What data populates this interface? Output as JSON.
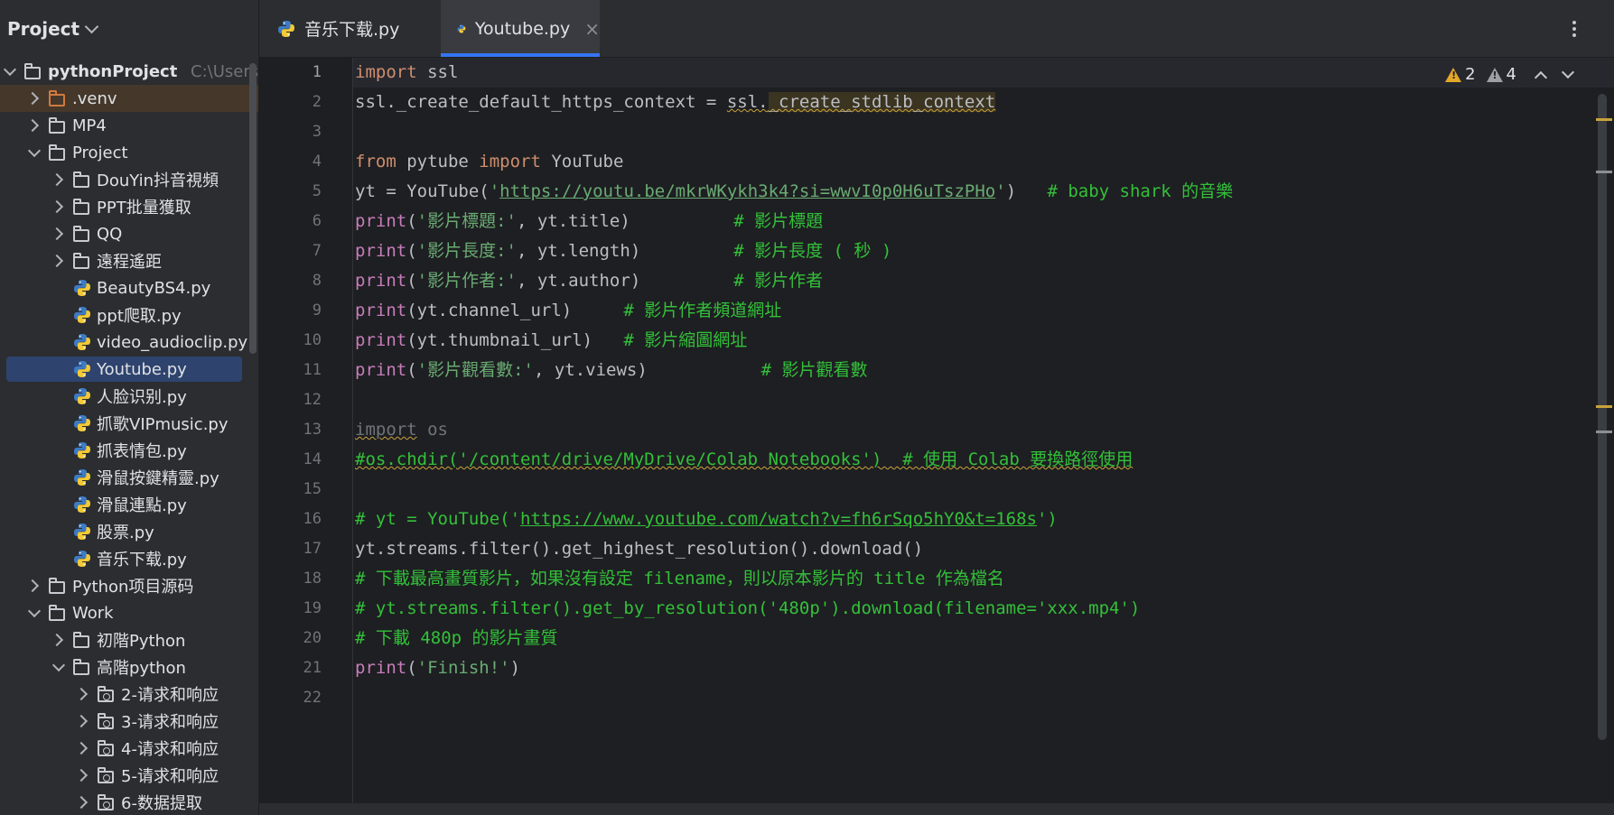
{
  "sidebar": {
    "header_label": "Project",
    "tree": [
      {
        "label": "pythonProject",
        "hint": "C:\\Users\\",
        "type": "folder",
        "expanded": true,
        "depth": 0,
        "bold": true
      },
      {
        "label": ".venv",
        "type": "folder-venv",
        "expanded": false,
        "depth": 1
      },
      {
        "label": "MP4",
        "type": "folder",
        "expanded": false,
        "depth": 1
      },
      {
        "label": "Project",
        "type": "folder",
        "expanded": true,
        "depth": 1
      },
      {
        "label": "DouYin抖音視頻",
        "type": "folder",
        "expanded": false,
        "depth": 2
      },
      {
        "label": "PPT批量獲取",
        "type": "folder",
        "expanded": false,
        "depth": 2
      },
      {
        "label": "QQ",
        "type": "folder",
        "expanded": false,
        "depth": 2
      },
      {
        "label": "遠程遙距",
        "type": "folder",
        "expanded": false,
        "depth": 2
      },
      {
        "label": "BeautyBS4.py",
        "type": "py",
        "depth": 2
      },
      {
        "label": "ppt爬取.py",
        "type": "py",
        "depth": 2
      },
      {
        "label": "video_audioclip.py",
        "type": "py",
        "depth": 2
      },
      {
        "label": "Youtube.py",
        "type": "py",
        "depth": 2,
        "selected": true
      },
      {
        "label": "人脸识别.py",
        "type": "py",
        "depth": 2
      },
      {
        "label": "抓歌VIPmusic.py",
        "type": "py",
        "depth": 2
      },
      {
        "label": "抓表情包.py",
        "type": "py",
        "depth": 2
      },
      {
        "label": "滑鼠按鍵精靈.py",
        "type": "py",
        "depth": 2
      },
      {
        "label": "滑鼠連點.py",
        "type": "py",
        "depth": 2
      },
      {
        "label": "股票.py",
        "type": "py",
        "depth": 2
      },
      {
        "label": "音乐下载.py",
        "type": "py",
        "depth": 2
      },
      {
        "label": "Python项目源码",
        "type": "folder",
        "expanded": false,
        "depth": 1
      },
      {
        "label": "Work",
        "type": "folder",
        "expanded": true,
        "depth": 1
      },
      {
        "label": "初階Python",
        "type": "folder",
        "expanded": false,
        "depth": 2
      },
      {
        "label": "高階python",
        "type": "folder",
        "expanded": true,
        "depth": 2
      },
      {
        "label": "2-请求和响应",
        "type": "package",
        "expanded": false,
        "depth": 3
      },
      {
        "label": "3-请求和响应",
        "type": "package",
        "expanded": false,
        "depth": 3
      },
      {
        "label": "4-请求和响应",
        "type": "package",
        "expanded": false,
        "depth": 3
      },
      {
        "label": "5-请求和响应",
        "type": "package",
        "expanded": false,
        "depth": 3
      },
      {
        "label": "6-数据提取",
        "type": "package",
        "expanded": false,
        "depth": 3
      }
    ]
  },
  "tabs": [
    {
      "label": "音乐下载.py",
      "active": false
    },
    {
      "label": "Youtube.py",
      "active": true,
      "close": "×"
    }
  ],
  "inspections": {
    "warnings": "2",
    "weak_warnings": "4"
  },
  "editor": {
    "line_numbers": [
      "1",
      "2",
      "3",
      "4",
      "5",
      "6",
      "7",
      "8",
      "9",
      "10",
      "11",
      "12",
      "13",
      "14",
      "15",
      "16",
      "17",
      "18",
      "19",
      "20",
      "21",
      "22"
    ],
    "lines": [
      [
        {
          "t": "import",
          "c": "kw"
        },
        {
          "t": " ssl",
          "c": ""
        }
      ],
      [
        {
          "t": "ssl._create_default_https_context = ",
          "c": ""
        },
        {
          "t": "ssl.",
          "c": "warnmark"
        },
        {
          "t": "_create_stdlib_context",
          "c": "warnmark hl"
        }
      ],
      [],
      [
        {
          "t": "from",
          "c": "kw"
        },
        {
          "t": " pytube ",
          "c": ""
        },
        {
          "t": "import",
          "c": "kw"
        },
        {
          "t": " YouTube",
          "c": ""
        }
      ],
      [
        {
          "t": "yt = YouTube(",
          "c": ""
        },
        {
          "t": "'",
          "c": "str"
        },
        {
          "t": "https://youtu.be/mkrWKykh3k4?si=wwvI0p0H6uTszPHo",
          "c": "url"
        },
        {
          "t": "'",
          "c": "str"
        },
        {
          "t": ")   ",
          "c": ""
        },
        {
          "t": "# baby shark 的音樂",
          "c": "cmt"
        }
      ],
      [
        {
          "t": "print",
          "c": "fn"
        },
        {
          "t": "(",
          "c": ""
        },
        {
          "t": "'影片標題:'",
          "c": "str"
        },
        {
          "t": ", yt.title)          ",
          "c": ""
        },
        {
          "t": "# 影片標題",
          "c": "cmt"
        }
      ],
      [
        {
          "t": "print",
          "c": "fn"
        },
        {
          "t": "(",
          "c": ""
        },
        {
          "t": "'影片長度:'",
          "c": "str"
        },
        {
          "t": ", yt.length)         ",
          "c": ""
        },
        {
          "t": "# 影片長度 ( 秒 )",
          "c": "cmt"
        }
      ],
      [
        {
          "t": "print",
          "c": "fn"
        },
        {
          "t": "(",
          "c": ""
        },
        {
          "t": "'影片作者:'",
          "c": "str"
        },
        {
          "t": ", yt.author)         ",
          "c": ""
        },
        {
          "t": "# 影片作者",
          "c": "cmt"
        }
      ],
      [
        {
          "t": "print",
          "c": "fn"
        },
        {
          "t": "(yt.channel_url)     ",
          "c": ""
        },
        {
          "t": "# 影片作者頻道網址",
          "c": "cmt"
        }
      ],
      [
        {
          "t": "print",
          "c": "fn"
        },
        {
          "t": "(yt.thumbnail_url)   ",
          "c": ""
        },
        {
          "t": "# 影片縮圖網址",
          "c": "cmt"
        }
      ],
      [
        {
          "t": "print",
          "c": "fn"
        },
        {
          "t": "(",
          "c": ""
        },
        {
          "t": "'影片觀看數:'",
          "c": "str"
        },
        {
          "t": ", yt.views)           ",
          "c": ""
        },
        {
          "t": "# 影片觀看數",
          "c": "cmt"
        }
      ],
      [],
      [
        {
          "t": "import",
          "c": "unused warnmark"
        },
        {
          "t": " os",
          "c": "unused"
        }
      ],
      [
        {
          "t": "#os.chdir('/content/drive/MyDrive/Colab Notebooks')  # 使用 Colab 要換路徑使用",
          "c": "cmt warnmark"
        }
      ],
      [],
      [
        {
          "t": "# yt = YouTube('",
          "c": "cmt"
        },
        {
          "t": "https://www.youtube.com/watch?v=fh6rSqo5hY0&t=168s",
          "c": "cmt url2"
        },
        {
          "t": "')",
          "c": "cmt"
        }
      ],
      [
        {
          "t": "yt.streams.filter().get_highest_resolution().download()",
          "c": ""
        }
      ],
      [
        {
          "t": "# 下載最高畫質影片，如果沒有設定 filename，則以原本影片的 title 作為檔名",
          "c": "cmt"
        }
      ],
      [
        {
          "t": "# yt.streams.filter().get_by_resolution('480p').download(filename='xxx.mp4')",
          "c": "cmt"
        }
      ],
      [
        {
          "t": "# 下載 480p 的影片畫質",
          "c": "cmt"
        }
      ],
      [
        {
          "t": "print",
          "c": "fn"
        },
        {
          "t": "(",
          "c": ""
        },
        {
          "t": "'Finish!'",
          "c": "str"
        },
        {
          "t": ")",
          "c": ""
        }
      ],
      []
    ]
  },
  "colors": {
    "accent": "#3574f0",
    "warning": "#e3a72a",
    "comment": "#33c03a"
  }
}
